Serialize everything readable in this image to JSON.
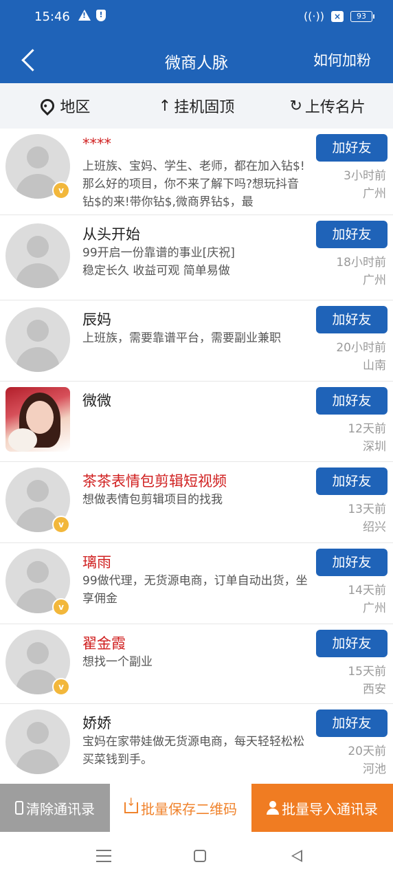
{
  "status_bar": {
    "time": "15:46",
    "battery": "93"
  },
  "header": {
    "title": "微商人脉",
    "right_action": "如何加粉"
  },
  "toolbar": [
    {
      "label": "地区",
      "icon": "location-pin-icon"
    },
    {
      "label": "挂机固顶",
      "icon": "up-arrow-icon"
    },
    {
      "label": "上传名片",
      "icon": "refresh-icon"
    }
  ],
  "contacts": [
    {
      "name": "****",
      "name_red": true,
      "vip": true,
      "photo": false,
      "desc": "上班族、宝妈、学生、老师，都在加入钻$!那么好的项目，你不来了解下吗?想玩抖音钻$的来!带你钻$,微商界钻$，最",
      "time": "3小时前",
      "location": "广州"
    },
    {
      "name": "从头开始",
      "name_red": false,
      "vip": false,
      "photo": false,
      "desc": "99开启一份靠谱的事业[庆祝]\n稳定长久 收益可观 简单易做",
      "time": "18小时前",
      "location": "广州"
    },
    {
      "name": "辰妈",
      "name_red": false,
      "vip": false,
      "photo": false,
      "desc": "上班族，需要靠谱平台，需要副业兼职",
      "time": "20小时前",
      "location": "山南"
    },
    {
      "name": "微微",
      "name_red": false,
      "vip": false,
      "photo": true,
      "desc": "",
      "time": "12天前",
      "location": "深圳"
    },
    {
      "name": "茶茶表情包剪辑短视频",
      "name_red": true,
      "vip": true,
      "photo": false,
      "desc": "想做表情包剪辑项目的找我",
      "time": "13天前",
      "location": "绍兴"
    },
    {
      "name": "璃雨",
      "name_red": true,
      "vip": true,
      "photo": false,
      "desc": "99做代理，无货源电商，订单自动出货，坐享佣金",
      "time": "14天前",
      "location": "广州"
    },
    {
      "name": "翟金霞",
      "name_red": true,
      "vip": true,
      "photo": false,
      "desc": "想找一个副业",
      "time": "15天前",
      "location": "西安"
    },
    {
      "name": "娇娇",
      "name_red": false,
      "vip": false,
      "photo": false,
      "desc": "宝妈在家带娃做无货源电商，每天轻轻松松买菜钱到手。",
      "time": "20天前",
      "location": "河池"
    }
  ],
  "add_friend_label": "加好友",
  "vip_badge_label": "v",
  "bottom_bar": {
    "clear_label": "清除通讯录",
    "save_label": "批量保存二维码",
    "import_label": "批量导入通讯录"
  },
  "colors": {
    "primary": "#1f63b8",
    "orange": "#f07c22",
    "gray": "#9e9e9e",
    "red_name": "#d02020"
  }
}
